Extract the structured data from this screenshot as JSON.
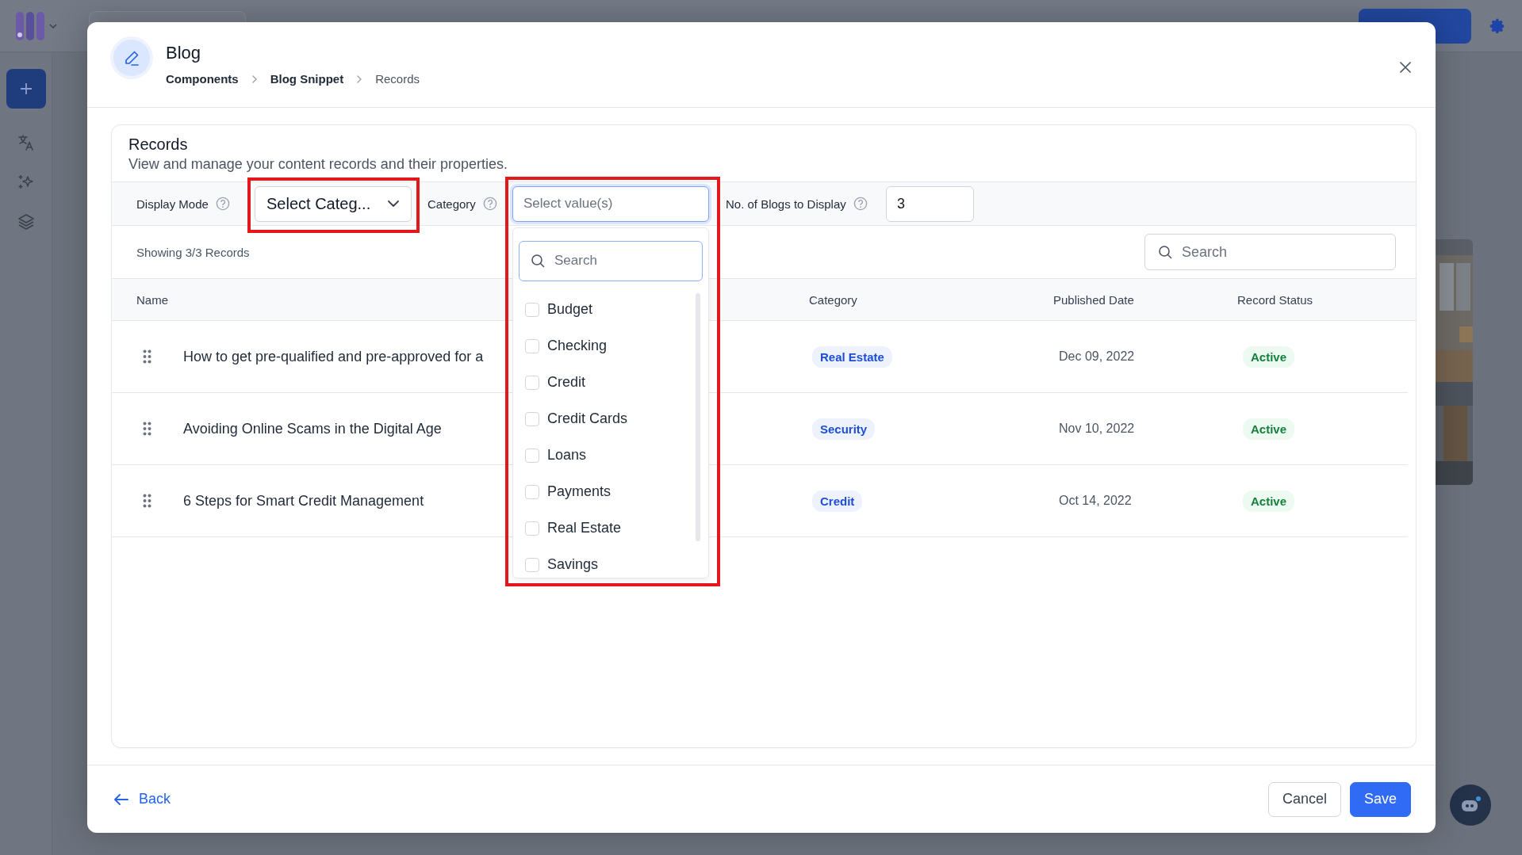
{
  "modal": {
    "title": "Blog",
    "breadcrumbs": [
      {
        "label": "Components",
        "current": false
      },
      {
        "label": "Blog Snippet",
        "current": false
      },
      {
        "label": "Records",
        "current": true
      }
    ]
  },
  "records": {
    "title": "Records",
    "description": "View and manage your content records and their properties.",
    "filters": [
      {
        "kind": "select",
        "label": "Display Mode",
        "value": "Select Categ..."
      },
      {
        "kind": "multiselect",
        "label": "Category",
        "placeholder": "Select value(s)",
        "expanded": true,
        "search_placeholder": "Search",
        "options": [
          {
            "label": "Budget",
            "checked": false
          },
          {
            "label": "Checking",
            "checked": false
          },
          {
            "label": "Credit",
            "checked": false
          },
          {
            "label": "Credit Cards",
            "checked": false
          },
          {
            "label": "Loans",
            "checked": false
          },
          {
            "label": "Payments",
            "checked": false
          },
          {
            "label": "Real Estate",
            "checked": false
          },
          {
            "label": "Savings",
            "checked": false
          }
        ]
      },
      {
        "kind": "number",
        "label": "No. of Blogs to Display",
        "value": "3"
      }
    ],
    "summary": "Showing 3/3 Records",
    "search": {
      "placeholder": "Search"
    },
    "table": {
      "columns": [
        "Name",
        "Category",
        "Published Date",
        "Record Status"
      ],
      "rows": [
        {
          "name": "How to get pre-qualified and pre-approved for a",
          "category": "Real Estate",
          "published": "Dec 09, 2022",
          "status": "Active"
        },
        {
          "name": "Avoiding Online Scams in the Digital Age",
          "category": "Security",
          "published": "Nov 10, 2022",
          "status": "Active"
        },
        {
          "name": "6 Steps for Smart Credit Management",
          "category": "Credit",
          "published": "Oct 14, 2022",
          "status": "Active"
        }
      ]
    }
  },
  "footer": {
    "back": "Back",
    "buttons": [
      {
        "label": "Cancel",
        "kind": "secondary"
      },
      {
        "label": "Save",
        "kind": "primary"
      }
    ]
  }
}
